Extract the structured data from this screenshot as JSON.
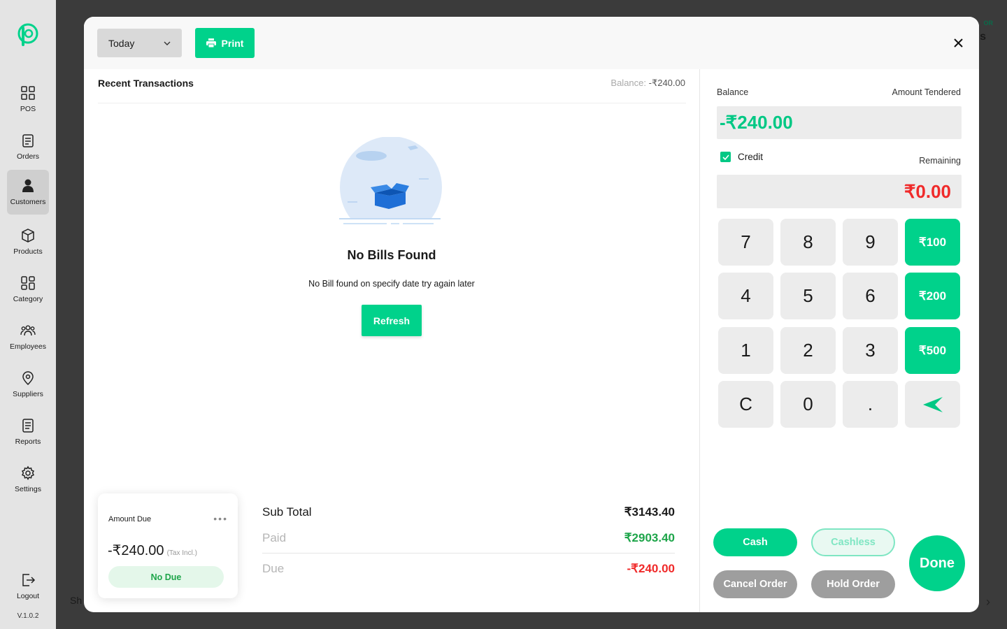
{
  "background": {
    "partial_letters_left": "Sh",
    "partial_corner_tag": "OR",
    "partial_corner_letter": "s"
  },
  "sidebar": {
    "items": [
      {
        "label": "POS",
        "icon": "grid-icon"
      },
      {
        "label": "Orders",
        "icon": "clipboard-icon"
      },
      {
        "label": "Customers",
        "icon": "person-icon"
      },
      {
        "label": "Products",
        "icon": "box-icon"
      },
      {
        "label": "Category",
        "icon": "category-icon"
      },
      {
        "label": "Employees",
        "icon": "group-icon"
      },
      {
        "label": "Suppliers",
        "icon": "location-icon"
      },
      {
        "label": "Reports",
        "icon": "report-icon"
      },
      {
        "label": "Settings",
        "icon": "gear-icon"
      }
    ],
    "logout": "Logout",
    "version": "V.1.0.2"
  },
  "header": {
    "date_filter": "Today",
    "print_label": "Print"
  },
  "transactions": {
    "title": "Recent Transactions",
    "balance_label": "Balance:",
    "balance_value": "-₹240.00",
    "empty_title": "No Bills Found",
    "empty_subtitle": "No Bill found on specify date try again later",
    "refresh_label": "Refresh"
  },
  "amount_due_card": {
    "title": "Amount Due",
    "amount": "-₹240.00",
    "tax_note": "(Tax Incl.)",
    "status": "No Due"
  },
  "summary": {
    "subtotal_label": "Sub Total",
    "subtotal_value": "₹3143.40",
    "paid_label": "Paid",
    "paid_value": "₹2903.40",
    "due_label": "Due",
    "due_value": "-₹240.00"
  },
  "payment": {
    "balance_label": "Balance",
    "amount_tendered_label": "Amount Tendered",
    "balance_value": "-₹240.00",
    "credit_label": "Credit",
    "credit_checked": true,
    "remaining_label": "Remaining",
    "remaining_value": "₹0.00",
    "keypad": [
      "7",
      "8",
      "9",
      "₹100",
      "4",
      "5",
      "6",
      "₹200",
      "1",
      "2",
      "3",
      "₹500",
      "C",
      "0",
      "."
    ],
    "cash_label": "Cash",
    "cashless_label": "Cashless",
    "cancel_label": "Cancel Order",
    "hold_label": "Hold Order",
    "done_label": "Done"
  },
  "colors": {
    "accent": "#00d28b",
    "danger": "#f02a2a",
    "success": "#1ea54a"
  }
}
